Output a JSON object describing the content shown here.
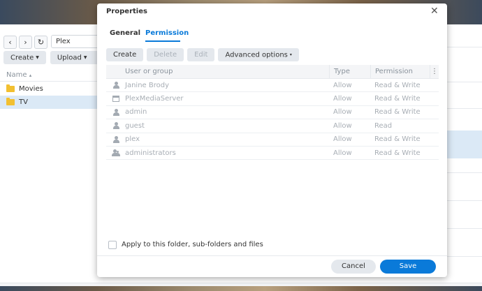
{
  "background_window": {
    "nav": {
      "back_icon": "chevron-left-icon",
      "forward_icon": "chevron-right-icon",
      "refresh_icon": "refresh-icon"
    },
    "path": "Plex",
    "toolbar": {
      "create_label": "Create",
      "upload_label": "Upload"
    },
    "list_header": {
      "name_label": "Name",
      "sort_glyph": "▴"
    },
    "items": [
      {
        "name": "Movies",
        "icon": "folder-icon"
      },
      {
        "name": "TV",
        "icon": "folder-icon",
        "selected": true
      }
    ]
  },
  "dialog": {
    "title": "Properties",
    "close_glyph": "✕",
    "tabs": [
      {
        "label": "General",
        "active": false
      },
      {
        "label": "Permission",
        "active": true
      }
    ],
    "toolbar": {
      "create_label": "Create",
      "delete_label": "Delete",
      "edit_label": "Edit",
      "advanced_label": "Advanced options",
      "caret_glyph": "▾"
    },
    "grid": {
      "columns": {
        "user": "User or group",
        "type": "Type",
        "permission": "Permission",
        "menu_glyph": "⋮"
      },
      "rows": [
        {
          "icon": "user-icon",
          "name": "Janine Brody",
          "type": "Allow",
          "permission": "Read & Write"
        },
        {
          "icon": "app-icon",
          "name": "PlexMediaServer",
          "type": "Allow",
          "permission": "Read & Write"
        },
        {
          "icon": "user-icon",
          "name": "admin",
          "type": "Allow",
          "permission": "Read & Write"
        },
        {
          "icon": "user-icon",
          "name": "guest",
          "type": "Allow",
          "permission": "Read"
        },
        {
          "icon": "user-icon",
          "name": "plex",
          "type": "Allow",
          "permission": "Read & Write"
        },
        {
          "icon": "group-icon",
          "name": "administrators",
          "type": "Allow",
          "permission": "Read & Write"
        }
      ]
    },
    "apply_checkbox": {
      "label": "Apply to this folder, sub-folders and files",
      "checked": false
    },
    "footer": {
      "cancel_label": "Cancel",
      "save_label": "Save"
    },
    "accent_color": "#0a7ad9"
  }
}
